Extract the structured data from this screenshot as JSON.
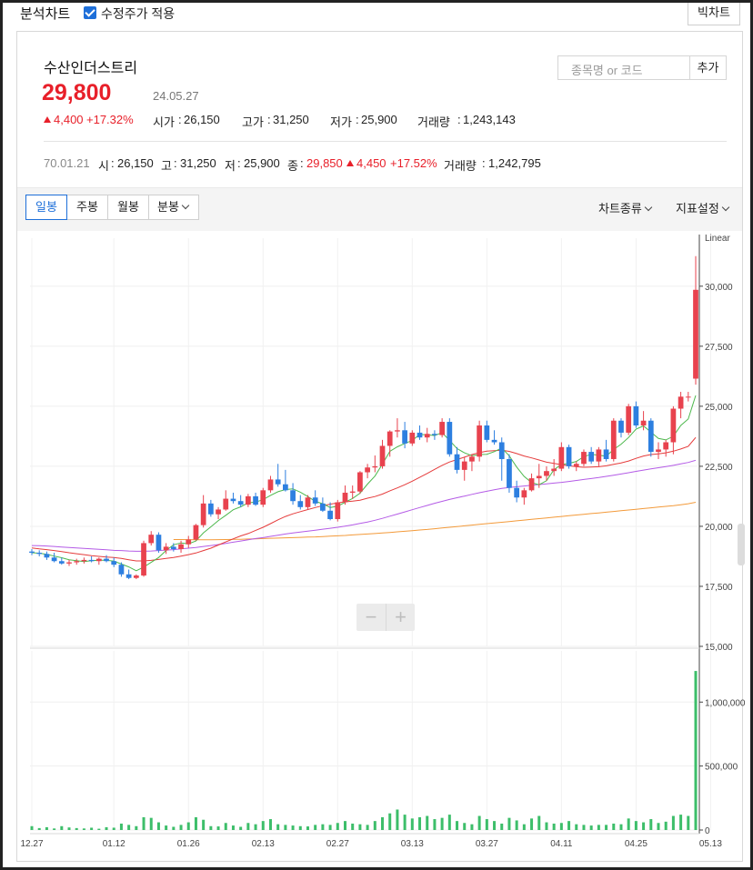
{
  "topbar": {
    "title": "분석차트",
    "adjusted_label": "수정주가 적용",
    "big_chart_label": "빅차트"
  },
  "stock": {
    "name": "수산인더스트리",
    "price": "29,800",
    "date": "24.05.27",
    "change": "4,400",
    "change_pct": "+17.32%",
    "open_label": "시가",
    "open": "26,150",
    "high_label": "고가",
    "high": "31,250",
    "low_label": "저가",
    "low": "25,900",
    "volume_label": "거래량",
    "volume": "1,243,143"
  },
  "search": {
    "placeholder": "종목명 or 코드",
    "add_label": "추가"
  },
  "ohlc_row": {
    "date": "70.01.21",
    "o_label": "시",
    "o": "26,150",
    "h_label": "고",
    "h": "31,250",
    "l_label": "저",
    "l": "25,900",
    "c_label": "종",
    "c": "29,850",
    "chg": "4,450",
    "chg_pct": "+17.52%",
    "v_label": "거래량",
    "v": "1,242,795"
  },
  "tabs": {
    "day": "일봉",
    "week": "주봉",
    "month": "월봉",
    "minute": "분봉",
    "chart_type": "차트종류",
    "indicators": "지표설정"
  },
  "colors": {
    "up": "#e8424e",
    "down": "#2d7fe0",
    "ma5": "#4cb84c",
    "ma20": "#e53b3b",
    "ma60": "#b45be6",
    "ma120": "#f39a3a",
    "volume": "#3dbe6a",
    "accent": "#1e6fd9"
  },
  "icons": {
    "zoom_out": "minus-icon",
    "zoom_in": "plus-icon",
    "check": "checkbox-checked-icon"
  },
  "zoom": {
    "minus": "−",
    "plus": "+"
  },
  "chart_data": {
    "type": "candlestick",
    "scale_label": "Linear",
    "x_tick_labels": [
      "12.27",
      "01.12",
      "01.26",
      "02.13",
      "02.27",
      "03.13",
      "03.27",
      "04.11",
      "04.25",
      "05.13"
    ],
    "x_tick_index": [
      0,
      11,
      21,
      31,
      41,
      51,
      61,
      71,
      81,
      91
    ],
    "price_ticks": [
      "30,000",
      "27,500",
      "25,000",
      "22,500",
      "20,000",
      "17,500",
      "15,000"
    ],
    "price_tick_values": [
      30000,
      27500,
      25000,
      22500,
      20000,
      17500,
      15000
    ],
    "ylim": [
      15000,
      32000
    ],
    "volume_ticks": [
      "1,000,000",
      "500,000",
      "0"
    ],
    "volume_tick_values": [
      1000000,
      500000,
      0
    ],
    "volume_ylim": [
      0,
      1400000
    ],
    "candles": [
      [
        18950,
        19050,
        18800,
        18900
      ],
      [
        18900,
        19000,
        18750,
        18850
      ],
      [
        18850,
        18950,
        18600,
        18700
      ],
      [
        18700,
        18900,
        18500,
        18550
      ],
      [
        18550,
        18700,
        18400,
        18450
      ],
      [
        18450,
        18600,
        18350,
        18500
      ],
      [
        18500,
        18650,
        18400,
        18550
      ],
      [
        18550,
        18700,
        18450,
        18600
      ],
      [
        18600,
        18750,
        18500,
        18550
      ],
      [
        18550,
        18700,
        18400,
        18650
      ],
      [
        18650,
        18800,
        18500,
        18550
      ],
      [
        18550,
        18700,
        18300,
        18400
      ],
      [
        18400,
        18500,
        17900,
        18000
      ],
      [
        18000,
        18200,
        17800,
        17850
      ],
      [
        17850,
        18000,
        17800,
        17950
      ],
      [
        17950,
        19400,
        17900,
        19300
      ],
      [
        19300,
        19800,
        19200,
        19650
      ],
      [
        19650,
        19750,
        18900,
        19000
      ],
      [
        19000,
        19300,
        18850,
        19150
      ],
      [
        19150,
        19300,
        18950,
        19050
      ],
      [
        19050,
        19400,
        18900,
        19250
      ],
      [
        19250,
        19600,
        19100,
        19450
      ],
      [
        19450,
        20100,
        19400,
        20050
      ],
      [
        20050,
        21300,
        19950,
        20950
      ],
      [
        20950,
        21100,
        20400,
        20500
      ],
      [
        20500,
        20800,
        20300,
        20700
      ],
      [
        20700,
        21500,
        20650,
        21150
      ],
      [
        21150,
        21400,
        20950,
        21050
      ],
      [
        21050,
        21300,
        20800,
        20900
      ],
      [
        20900,
        21350,
        20800,
        21250
      ],
      [
        21250,
        21400,
        20850,
        20900
      ],
      [
        20900,
        21600,
        20800,
        21500
      ],
      [
        21500,
        22100,
        21400,
        21950
      ],
      [
        21950,
        22600,
        21650,
        21750
      ],
      [
        21750,
        22350,
        21450,
        21500
      ],
      [
        21500,
        21800,
        20900,
        21050
      ],
      [
        21050,
        21300,
        20700,
        20800
      ],
      [
        20800,
        21300,
        20700,
        21200
      ],
      [
        21200,
        21500,
        20850,
        20950
      ],
      [
        20950,
        21200,
        20600,
        20650
      ],
      [
        20650,
        21000,
        20250,
        20300
      ],
      [
        20300,
        21100,
        20200,
        21000
      ],
      [
        21000,
        21700,
        20900,
        21400
      ],
      [
        21400,
        21700,
        21150,
        21450
      ],
      [
        21450,
        22300,
        21350,
        22250
      ],
      [
        22250,
        22600,
        22000,
        22450
      ],
      [
        22450,
        22950,
        22250,
        22500
      ],
      [
        22500,
        23600,
        22400,
        23350
      ],
      [
        23350,
        24000,
        22900,
        23950
      ],
      [
        23950,
        24500,
        23700,
        24000
      ],
      [
        24000,
        24350,
        23250,
        23450
      ],
      [
        23450,
        24000,
        23350,
        23900
      ],
      [
        23900,
        24200,
        23600,
        23700
      ],
      [
        23700,
        24100,
        23500,
        23850
      ],
      [
        23850,
        24000,
        23600,
        23800
      ],
      [
        23800,
        24500,
        23700,
        24350
      ],
      [
        24350,
        24500,
        22900,
        23000
      ],
      [
        23000,
        23300,
        22200,
        22350
      ],
      [
        22350,
        22900,
        21900,
        22700
      ],
      [
        22700,
        23000,
        22300,
        22900
      ],
      [
        22900,
        24400,
        22700,
        24200
      ],
      [
        24200,
        24400,
        23500,
        23600
      ],
      [
        23600,
        24000,
        23400,
        23500
      ],
      [
        23500,
        23700,
        21900,
        22800
      ],
      [
        22800,
        23000,
        21400,
        21600
      ],
      [
        21600,
        21900,
        21000,
        21200
      ],
      [
        21200,
        21600,
        20900,
        21500
      ],
      [
        21500,
        22200,
        21450,
        22000
      ],
      [
        22000,
        22600,
        21600,
        22100
      ],
      [
        22100,
        22500,
        21900,
        22300
      ],
      [
        22300,
        22800,
        22100,
        22400
      ],
      [
        22400,
        23500,
        22300,
        23300
      ],
      [
        23300,
        23400,
        22400,
        22500
      ],
      [
        22500,
        22700,
        22300,
        22600
      ],
      [
        22600,
        23200,
        22500,
        23100
      ],
      [
        23100,
        23300,
        22600,
        22700
      ],
      [
        22700,
        23300,
        22500,
        23200
      ],
      [
        23200,
        23600,
        22700,
        22800
      ],
      [
        22800,
        24500,
        22700,
        24400
      ],
      [
        24400,
        24500,
        23700,
        23900
      ],
      [
        23900,
        25100,
        23800,
        25000
      ],
      [
        25000,
        25200,
        24100,
        24200
      ],
      [
        24200,
        24800,
        24000,
        24400
      ],
      [
        24400,
        24500,
        22900,
        23100
      ],
      [
        23100,
        23500,
        22800,
        23200
      ],
      [
        23200,
        23600,
        22900,
        23500
      ],
      [
        23500,
        25000,
        23000,
        24900
      ],
      [
        24900,
        25600,
        24500,
        25400
      ],
      [
        25400,
        25600,
        25200,
        25400
      ],
      [
        26150,
        31250,
        25900,
        29850
      ]
    ],
    "ma5": [
      18900,
      18880,
      18830,
      18760,
      18690,
      18610,
      18570,
      18530,
      18570,
      18590,
      18590,
      18550,
      18430,
      18310,
      18150,
      18300,
      18500,
      18700,
      18990,
      19230,
      19310,
      19270,
      19390,
      19730,
      19980,
      20240,
      20460,
      20690,
      20810,
      20980,
      21010,
      21110,
      21290,
      21440,
      21530,
      21560,
      21420,
      21240,
      21040,
      20940,
      20780,
      20840,
      21000,
      21160,
      21380,
      21760,
      22090,
      22590,
      23120,
      23310,
      23450,
      23580,
      23820,
      23810,
      23780,
      23900,
      23580,
      23240,
      23060,
      22940,
      22990,
      23000,
      23110,
      23260,
      22940,
      22470,
      22080,
      21820,
      21730,
      21900,
      22360,
      22580,
      22620,
      22700,
      22900,
      23000,
      22960,
      22920,
      23200,
      23420,
      23700,
      24050,
      24180,
      23920,
      23660,
      23600,
      23750,
      24200,
      24470,
      25450
    ],
    "ma20": [
      19100,
      19060,
      19030,
      18990,
      18950,
      18900,
      18860,
      18820,
      18780,
      18750,
      18720,
      18700,
      18660,
      18610,
      18560,
      18560,
      18580,
      18620,
      18660,
      18700,
      18760,
      18820,
      18890,
      18990,
      19090,
      19220,
      19350,
      19480,
      19600,
      19700,
      19830,
      19960,
      20110,
      20270,
      20410,
      20520,
      20610,
      20700,
      20780,
      20860,
      20920,
      20980,
      21020,
      21050,
      21090,
      21170,
      21240,
      21340,
      21480,
      21600,
      21730,
      21880,
      22040,
      22200,
      22370,
      22540,
      22680,
      22780,
      22880,
      22990,
      23070,
      23130,
      23150,
      23170,
      23120,
      23030,
      22930,
      22850,
      22760,
      22670,
      22620,
      22570,
      22520,
      22480,
      22460,
      22470,
      22480,
      22520,
      22580,
      22640,
      22720,
      22830,
      22930,
      22990,
      23020,
      23060,
      23130,
      23220,
      23330,
      23700
    ],
    "ma60": [
      19200,
      19190,
      19180,
      19160,
      19140,
      19120,
      19100,
      19080,
      19060,
      19040,
      19020,
      19000,
      18990,
      18970,
      18960,
      18960,
      18970,
      18990,
      19010,
      19030,
      19060,
      19090,
      19120,
      19160,
      19200,
      19240,
      19290,
      19340,
      19390,
      19440,
      19490,
      19530,
      19580,
      19630,
      19680,
      19720,
      19760,
      19800,
      19840,
      19880,
      19920,
      19960,
      20010,
      20060,
      20120,
      20180,
      20250,
      20330,
      20420,
      20510,
      20600,
      20690,
      20780,
      20870,
      20960,
      21040,
      21120,
      21190,
      21260,
      21330,
      21400,
      21460,
      21520,
      21580,
      21620,
      21650,
      21680,
      21710,
      21740,
      21770,
      21800,
      21830,
      21870,
      21910,
      21950,
      21990,
      22030,
      22080,
      22130,
      22180,
      22230,
      22290,
      22340,
      22390,
      22440,
      22490,
      22540,
      22600,
      22660,
      22750
    ],
    "ma120": [
      null,
      null,
      null,
      null,
      null,
      null,
      null,
      null,
      null,
      null,
      null,
      null,
      null,
      null,
      null,
      null,
      null,
      null,
      null,
      19450,
      19450,
      19445,
      19440,
      19440,
      19440,
      19445,
      19450,
      19455,
      19460,
      19470,
      19480,
      19490,
      19500,
      19510,
      19520,
      19530,
      19540,
      19550,
      19560,
      19575,
      19590,
      19605,
      19620,
      19640,
      19660,
      19680,
      19700,
      19720,
      19745,
      19770,
      19795,
      19820,
      19845,
      19870,
      19900,
      19930,
      19960,
      19990,
      20020,
      20050,
      20080,
      20110,
      20140,
      20170,
      20200,
      20230,
      20260,
      20290,
      20320,
      20350,
      20380,
      20410,
      20440,
      20470,
      20500,
      20530,
      20560,
      20590,
      20620,
      20650,
      20680,
      20710,
      20740,
      20770,
      20800,
      20830,
      20860,
      20900,
      20940,
      21000
    ],
    "volume": [
      30000,
      15000,
      22000,
      12000,
      30000,
      20000,
      15000,
      12000,
      18000,
      10000,
      22000,
      18000,
      50000,
      40000,
      30000,
      100000,
      95000,
      60000,
      35000,
      25000,
      40000,
      60000,
      100000,
      80000,
      30000,
      28000,
      55000,
      35000,
      25000,
      55000,
      45000,
      70000,
      85000,
      45000,
      40000,
      35000,
      30000,
      28000,
      40000,
      45000,
      40000,
      55000,
      70000,
      50000,
      45000,
      40000,
      70000,
      100000,
      130000,
      160000,
      120000,
      90000,
      100000,
      110000,
      85000,
      95000,
      120000,
      70000,
      55000,
      45000,
      110000,
      85000,
      70000,
      50000,
      95000,
      75000,
      45000,
      90000,
      110000,
      60000,
      50000,
      55000,
      70000,
      45000,
      40000,
      35000,
      40000,
      40000,
      50000,
      45000,
      90000,
      70000,
      60000,
      85000,
      55000,
      65000,
      110000,
      120000,
      110000,
      1243143
    ]
  }
}
